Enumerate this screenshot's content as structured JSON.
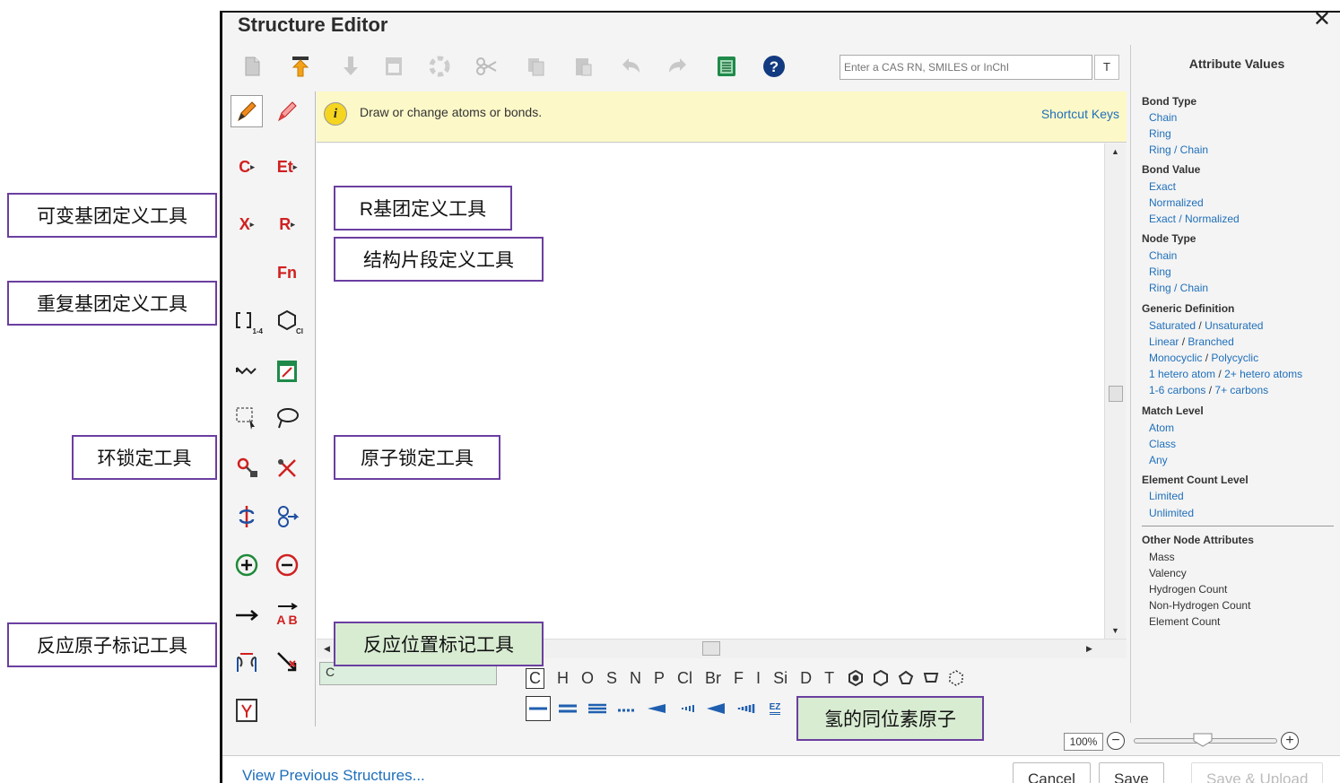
{
  "window": {
    "title": "Structure Editor",
    "close": "✕"
  },
  "toolbar": {
    "items": [
      "new-icon",
      "open-icon",
      "export-icon",
      "clear-icon",
      "transform-icon",
      "cut-icon",
      "copy-icon",
      "paste-icon",
      "undo-icon",
      "redo-icon",
      "list-icon",
      "help-icon"
    ],
    "search_placeholder": "Enter a CAS RN, SMILES or InChI",
    "text_tool": "T"
  },
  "hint": {
    "text": "Draw or change atoms or bonds.",
    "shortcut_keys": "Shortcut Keys",
    "icon": "i"
  },
  "left_tools": {
    "carbon": "C",
    "ethyl": "Et",
    "x_variable": "X",
    "r_group": "R",
    "functional": "Fn",
    "repeat_range": "1-4",
    "ring_label": "Cl",
    "reaction_a": "A",
    "reaction_b": "B"
  },
  "atom_field": "C",
  "elements": [
    "C",
    "H",
    "O",
    "S",
    "N",
    "P",
    "Cl",
    "Br",
    "F",
    "I",
    "Si",
    "D",
    "T"
  ],
  "bond_ez": "EZ",
  "zoom": {
    "value": "100%",
    "minus": "−",
    "plus": "+",
    "level": 0.45
  },
  "footer": {
    "view_previous": "View Previous Structures...",
    "cancel": "Cancel",
    "save": "Save",
    "save_upload": "Save & Upload"
  },
  "attributes": {
    "title": "Attribute Values",
    "bond_type": {
      "label": "Bond Type",
      "items": [
        "Chain",
        "Ring",
        "Ring / Chain"
      ]
    },
    "bond_value": {
      "label": "Bond Value",
      "items": [
        "Exact",
        "Normalized",
        "Exact / Normalized"
      ]
    },
    "node_type": {
      "label": "Node Type",
      "items": [
        "Chain",
        "Ring",
        "Ring / Chain"
      ]
    },
    "generic": {
      "label": "Generic Definition",
      "items": [
        [
          "Saturated",
          "Unsaturated"
        ],
        [
          "Linear",
          "Branched"
        ],
        [
          "Monocyclic",
          "Polycyclic"
        ],
        [
          "1 hetero atom",
          "2+ hetero atoms"
        ],
        [
          "1-6 carbons",
          "7+ carbons"
        ]
      ]
    },
    "match_level": {
      "label": "Match Level",
      "items": [
        "Atom",
        "Class",
        "Any"
      ]
    },
    "element_count": {
      "label": "Element Count Level",
      "items": [
        "Limited",
        "Unlimited"
      ]
    },
    "other": {
      "label": "Other Node Attributes",
      "items": [
        "Mass",
        "Valency",
        "Hydrogen Count",
        "Non-Hydrogen Count",
        "Element Count"
      ]
    },
    "separator": "/"
  },
  "callouts": {
    "variable_group": "可变基团定义工具",
    "r_group": "R基团定义工具",
    "fragment": "结构片段定义工具",
    "repeat_group": "重复基团定义工具",
    "ring_lock": "环锁定工具",
    "atom_lock": "原子锁定工具",
    "reaction_atom": "反应原子标记工具",
    "reaction_site": "反应位置标记工具",
    "hydrogen_isotope": "氢的同位素原子"
  }
}
